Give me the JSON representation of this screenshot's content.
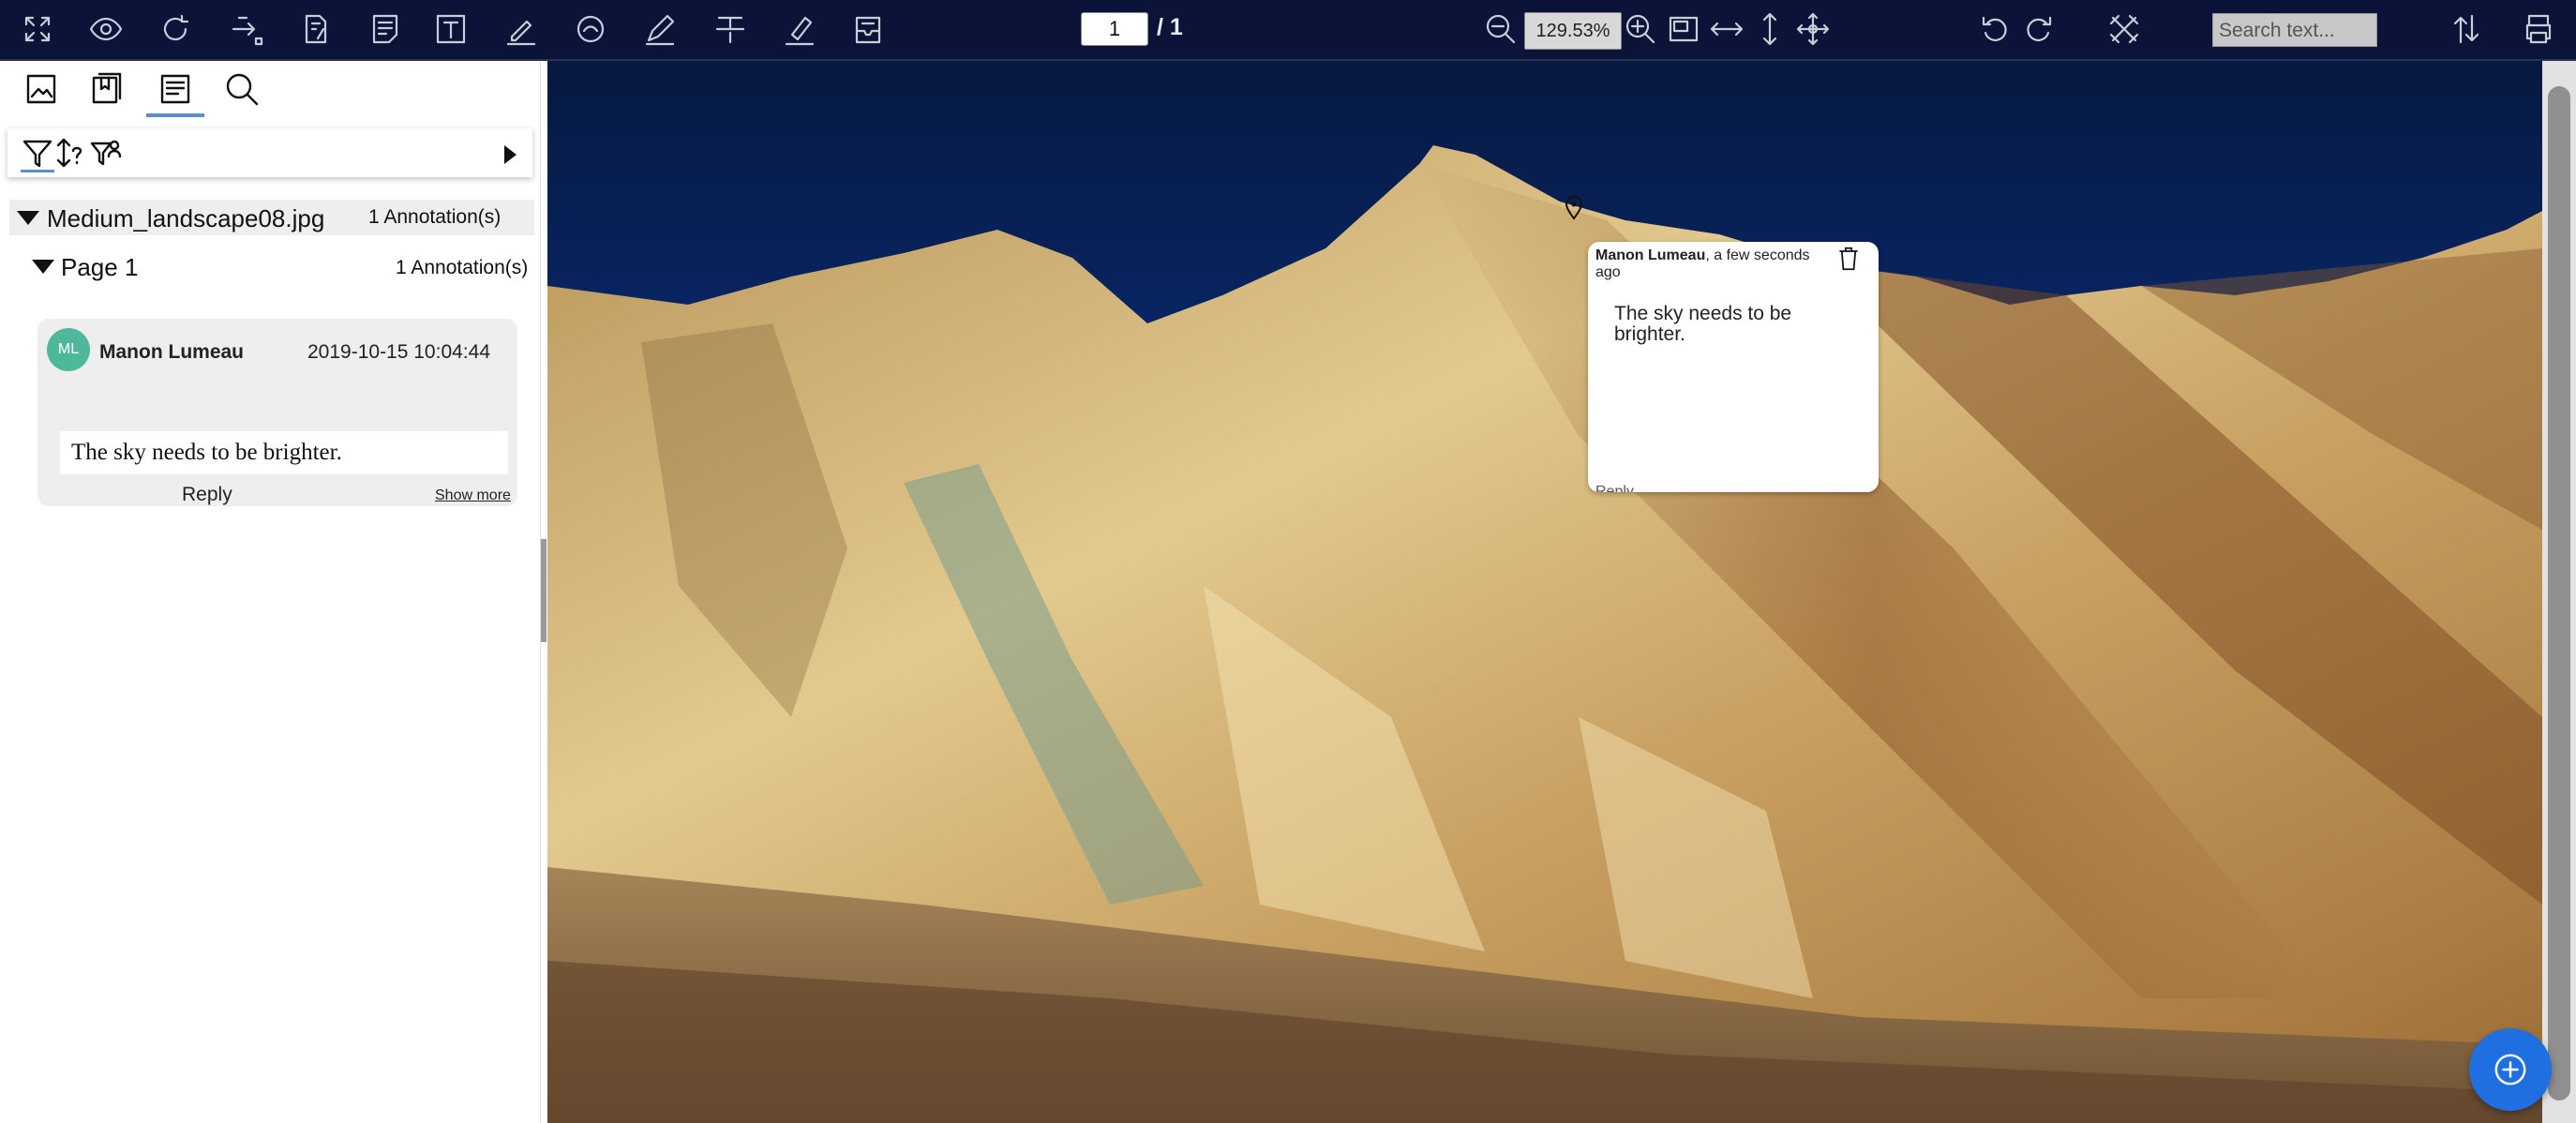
{
  "toolbar": {
    "page_current": "1",
    "page_total": "/ 1",
    "zoom": "129.53%",
    "search_placeholder": "Search text...",
    "icons": [
      "fullscreen-icon",
      "eye-icon",
      "refresh-icon",
      "link-icon",
      "page-edit-icon",
      "note-icon",
      "text-box-icon",
      "pen-icon",
      "circle-arrow-icon",
      "pencil-icon",
      "strikethrough-icon",
      "highlighter-icon",
      "inbox-icon",
      "zoom-out-icon",
      "zoom-in-icon",
      "fit-page-icon",
      "fit-width-icon",
      "fit-height-icon",
      "move-icon",
      "rotate-left-icon",
      "rotate-right-icon",
      "crop-icon",
      "sort-icon",
      "print-icon"
    ]
  },
  "sidebar": {
    "tabs": [
      "thumbnails-icon",
      "bookmarks-icon",
      "annotations-icon",
      "search-icon"
    ],
    "active_tab": "annotations-icon",
    "file": {
      "name": "Medium_landscape08.jpg",
      "count": "1 Annotation(s)"
    },
    "page": {
      "name": "Page 1",
      "count": "1 Annotation(s)"
    },
    "annotation": {
      "initials": "ML",
      "author": "Manon Lumeau",
      "date": "2019-10-15 10:04:44",
      "text": "The sky needs to be brighter.",
      "reply_label": "Reply",
      "show_more": "Show more"
    }
  },
  "viewer": {
    "note": {
      "author": "Manon Lumeau",
      "time": ", a few seconds ago",
      "text": "The sky needs to be brighter.",
      "reply_label": "Reply"
    }
  },
  "colors": {
    "toolbar_bg": "#0b1438",
    "accent": "#5a8fc8",
    "avatar": "#4eb89a",
    "fab": "#1f6fe0"
  }
}
